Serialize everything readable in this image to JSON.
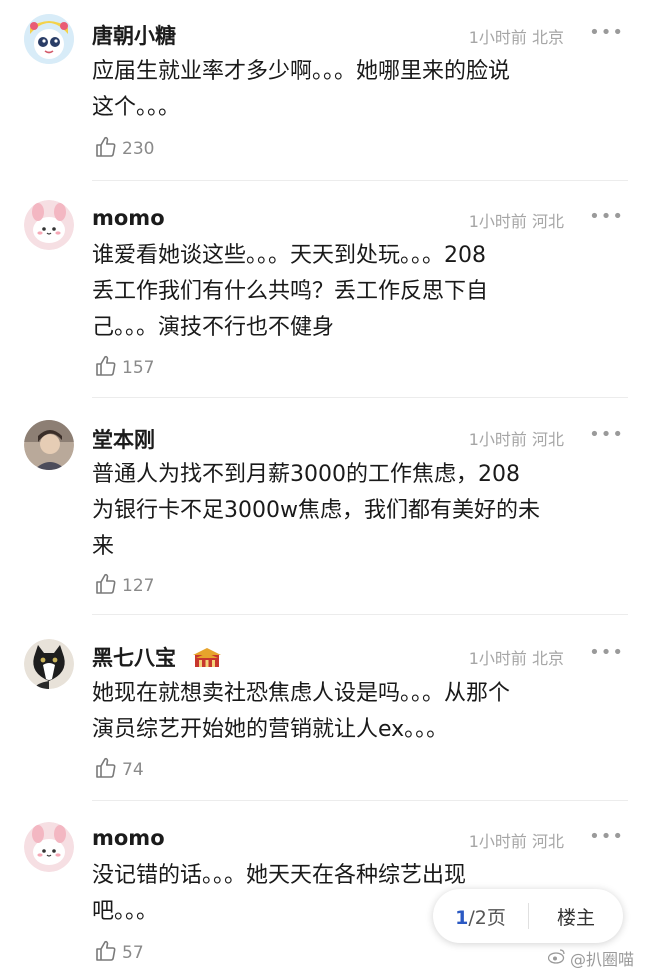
{
  "comments": [
    {
      "name": "唐朝小糖",
      "time": "1小时前",
      "location": "北京",
      "lines": [
        "应届生就业率才多少啊。。。她哪里来的脸说",
        "这个。。。"
      ],
      "likes": "230",
      "avatar_icon": "cartoon-girl-avatar-icon"
    },
    {
      "name": "momo",
      "time": "1小时前",
      "location": "河北",
      "lines": [
        "谁爱看她谈这些。。。天天到处玩。。。208",
        "丢工作我们有什么共鸣？丢工作反思下自",
        "己。。。演技不行也不健身"
      ],
      "likes": "157",
      "avatar_icon": "pink-bunny-avatar-icon"
    },
    {
      "name": "堂本刚",
      "time": "1小时前",
      "location": "河北",
      "lines": [
        "普通人为找不到月薪3000的工作焦虑，208",
        "为银行卡不足3000w焦虑，我们都有美好的未",
        "来"
      ],
      "likes": "127",
      "avatar_icon": "photo-portrait-avatar-icon"
    },
    {
      "name": "黑七八宝",
      "time": "1小时前",
      "location": "北京",
      "lines": [
        "她现在就想卖社恐焦虑人设是吗。。。从那个",
        "演员综艺开始她的营销就让人ex。。。"
      ],
      "likes": "74",
      "avatar_icon": "black-cat-avatar-icon",
      "badge_icon": "palace-badge-icon"
    },
    {
      "name": "momo",
      "time": "1小时前",
      "location": "河北",
      "lines": [
        "没记错的话。。。她天天在各种综艺出现",
        "吧。。。"
      ],
      "likes": "57",
      "avatar_icon": "pink-bunny-avatar-icon"
    }
  ],
  "pager": {
    "current": "1",
    "rest": "/2页",
    "floor_owner": "楼主"
  },
  "watermark": "@扒圈喵",
  "more_symbol": "•••",
  "colors": {
    "accent": "#2b59c3",
    "meta": "#a6a6a6"
  }
}
